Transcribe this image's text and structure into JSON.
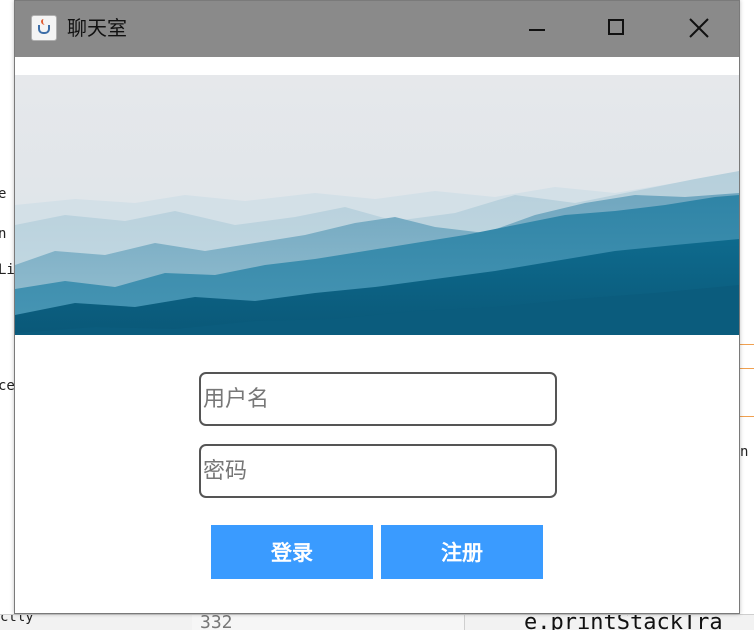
{
  "window": {
    "title": "聊天室",
    "app_icon": "java-cup-icon",
    "controls": {
      "minimize_icon": "minimize-icon",
      "maximize_icon": "maximize-icon",
      "close_icon": "close-icon"
    }
  },
  "banner": {
    "image": "misty-blue-mountains",
    "colors": {
      "sky": "#e8ebee",
      "mountain_light": "#a9c8d6",
      "mountain_mid": "#4f93ad",
      "mountain_dark": "#0f6587"
    }
  },
  "login_form": {
    "username_placeholder": "用户名",
    "password_placeholder": "密码",
    "login_label": "登录",
    "register_label": "注册",
    "button_color": "#3a9bff"
  },
  "background": {
    "left_fragments": [
      "e",
      "n",
      "Li",
      "ce",
      "ctly"
    ],
    "right_fragment": "n",
    "line_number": "332",
    "code_line": "e.printStackTra"
  }
}
